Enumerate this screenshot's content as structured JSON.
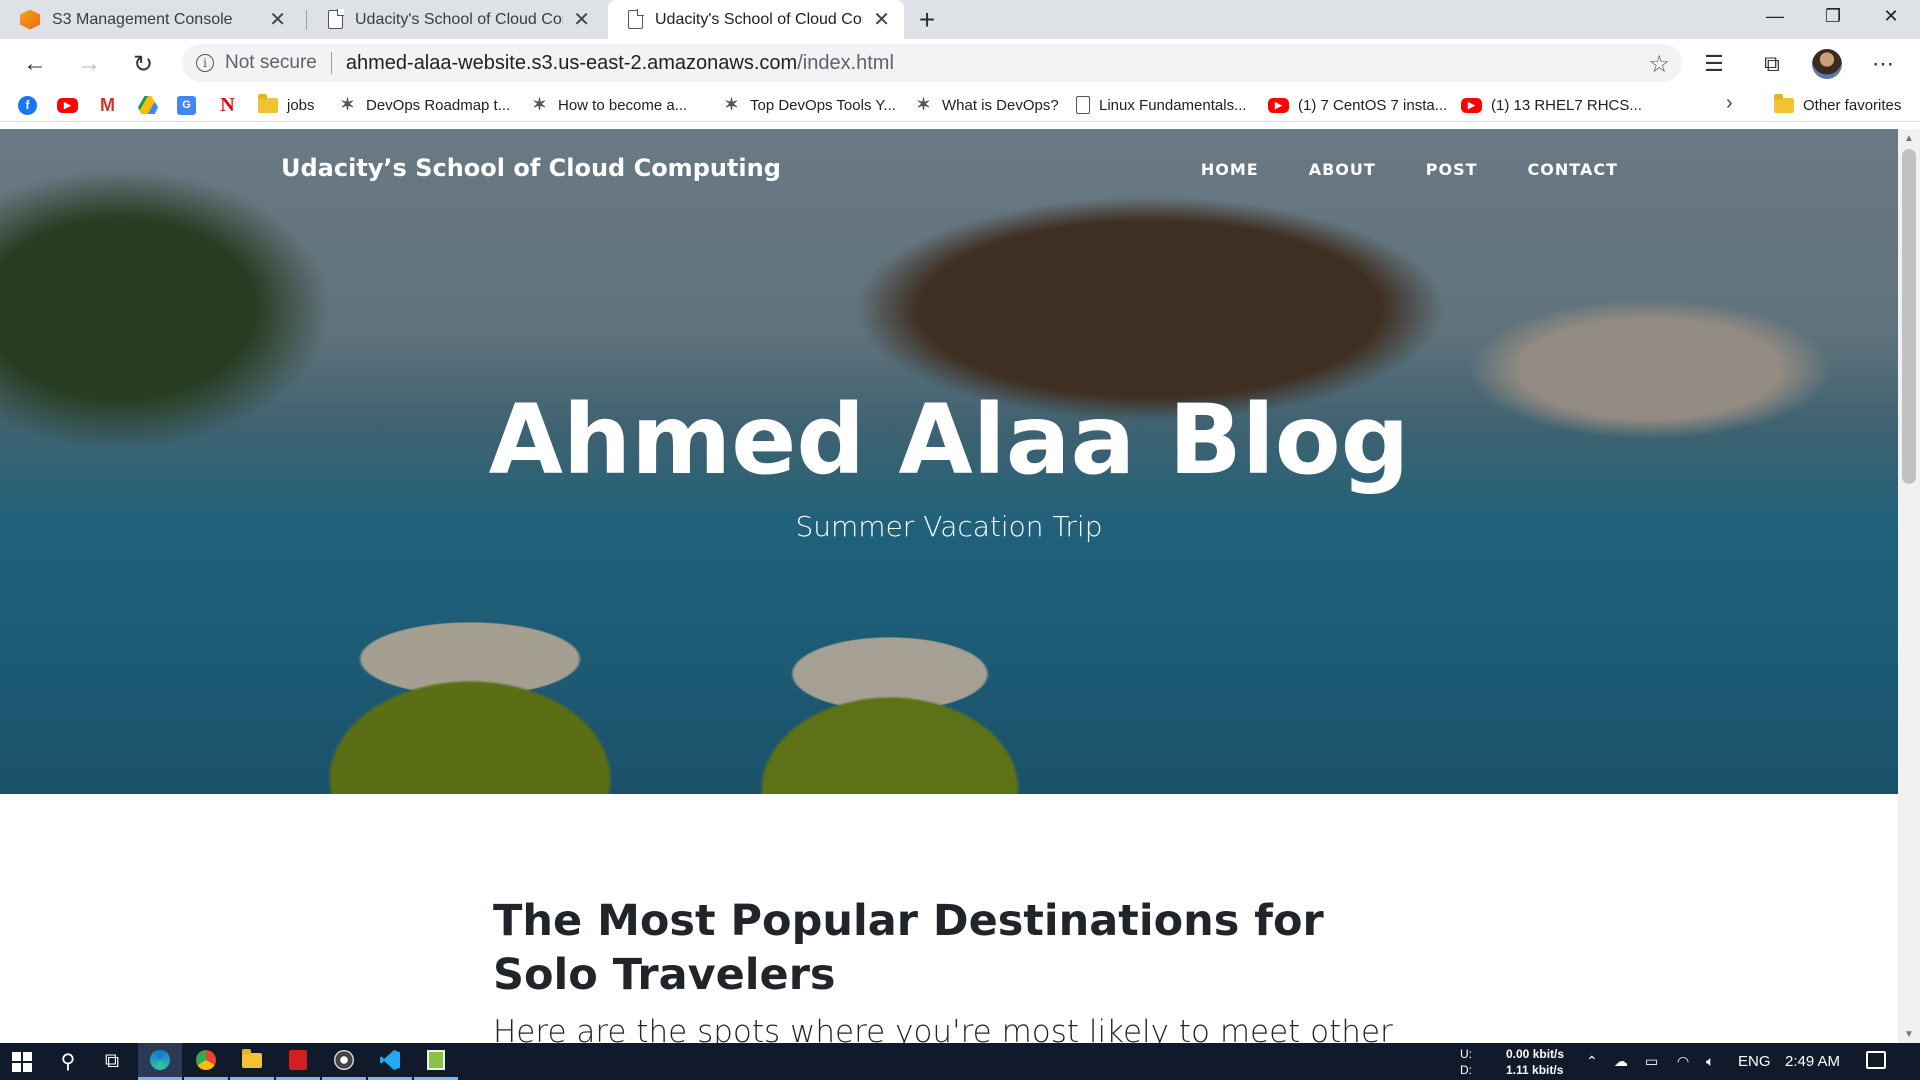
{
  "browser": {
    "tabs": [
      {
        "title": "S3 Management Console",
        "icon": "aws-s3-icon"
      },
      {
        "title": "Udacity's School of Cloud Computing",
        "icon": "page-icon"
      },
      {
        "title": "Udacity's School of Cloud Computing",
        "icon": "page-icon",
        "active": true
      }
    ],
    "new_tab": "+",
    "window_controls": {
      "minimize": "—",
      "restore": "❐",
      "close": "✕"
    },
    "nav": {
      "back": "←",
      "forward": "→",
      "reload": "↻"
    },
    "address": {
      "security_text": "Not secure",
      "host": "ahmed-alaa-website.s3.us-east-2.amazonaws.com",
      "path": "/index.html"
    },
    "bookmarks": [
      {
        "label": "",
        "icon": "facebook-icon"
      },
      {
        "label": "",
        "icon": "youtube-icon"
      },
      {
        "label": "",
        "icon": "gmail-icon"
      },
      {
        "label": "",
        "icon": "google-drive-icon"
      },
      {
        "label": "",
        "icon": "google-translate-icon"
      },
      {
        "label": "",
        "icon": "netflix-icon"
      },
      {
        "label": "jobs",
        "icon": "folder-icon"
      },
      {
        "label": "DevOps Roadmap t...",
        "icon": "roadmap-icon"
      },
      {
        "label": "How to become a...",
        "icon": "roadmap-icon"
      },
      {
        "label": "Top DevOps Tools Y...",
        "icon": "roadmap-icon"
      },
      {
        "label": "What is DevOps?",
        "icon": "roadmap-icon"
      },
      {
        "label": "Linux Fundamentals...",
        "icon": "page-icon"
      },
      {
        "label": "(1) 7 CentOS 7 insta...",
        "icon": "youtube-icon"
      },
      {
        "label": "(1) 13 RHEL7 RHCS...",
        "icon": "youtube-icon"
      }
    ],
    "other_favorites": "Other favorites"
  },
  "site": {
    "brand": "Udacity’s School of Cloud Computing",
    "nav": [
      "HOME",
      "ABOUT",
      "POST",
      "CONTACT"
    ],
    "hero_title": "Ahmed Alaa Blog",
    "hero_subtitle": "Summer Vacation Trip",
    "post_title": "The Most Popular Destinations for Solo Travelers",
    "post_subtitle": "Here are the spots where you're most likely to meet other"
  },
  "taskbar": {
    "netspeed": {
      "up_label": "U:",
      "up_value": "0.00 kbit/s",
      "down_label": "D:",
      "down_value": "1.11 kbit/s"
    },
    "language": "ENG",
    "time": "2:49 AM"
  }
}
